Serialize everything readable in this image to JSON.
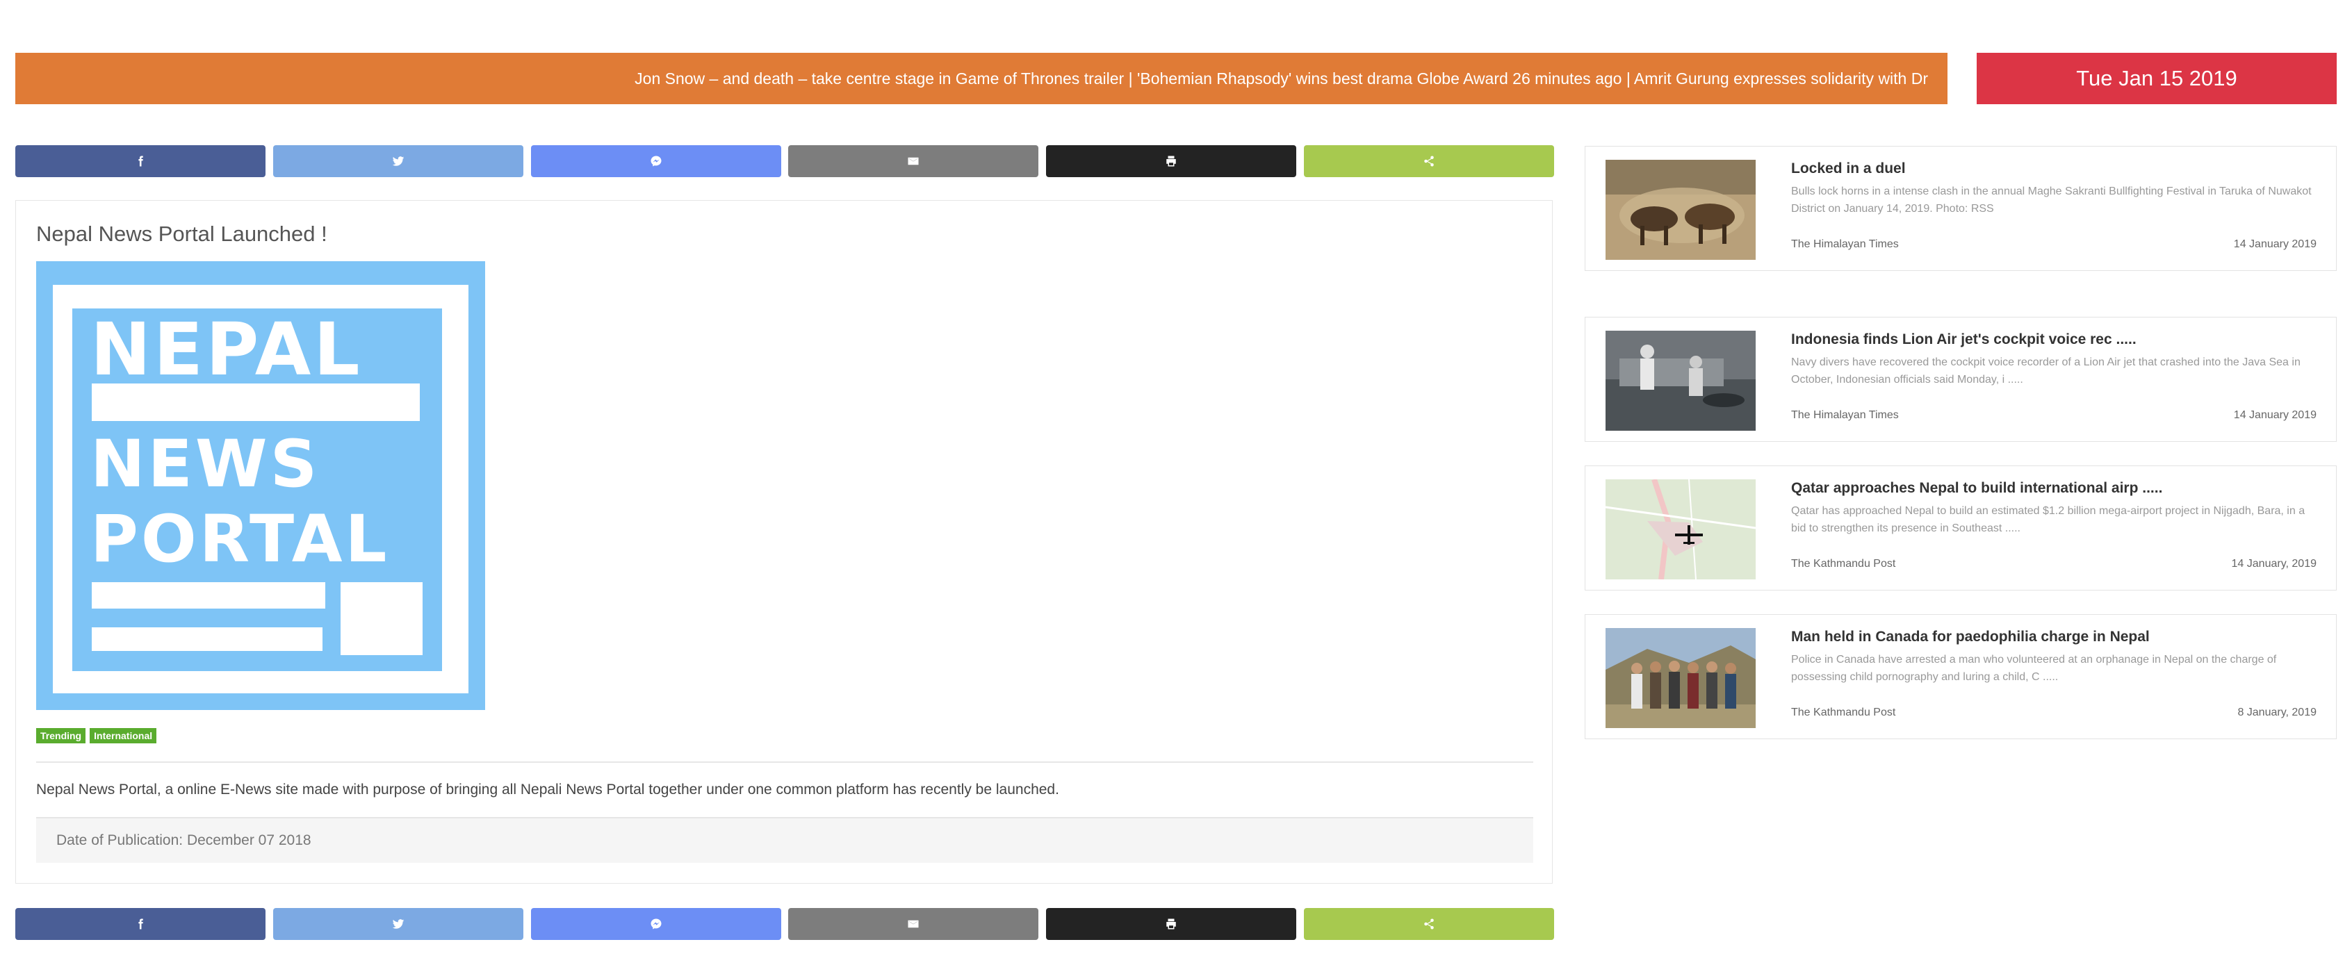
{
  "ticker": {
    "text": "Jon Snow – and death – take centre stage in Game of Thrones trailer | 'Bohemian Rhapsody' wins best drama Globe Award 26 minutes ago | Amrit Gurung expresses solidarity with Dr"
  },
  "date": "Tue Jan 15 2019",
  "share_buttons": [
    {
      "name": "facebook",
      "icon": "facebook-icon",
      "color": "#4a5e96"
    },
    {
      "name": "twitter",
      "icon": "twitter-icon",
      "color": "#7ca9e3"
    },
    {
      "name": "messenger",
      "icon": "messenger-icon",
      "color": "#6c8ef5"
    },
    {
      "name": "email",
      "icon": "email-icon",
      "color": "#7d7d7d"
    },
    {
      "name": "print",
      "icon": "print-icon",
      "color": "#232323"
    },
    {
      "name": "share",
      "icon": "share-icon",
      "color": "#a7c94f"
    }
  ],
  "article": {
    "title": "Nepal News Portal Launched !",
    "logo": {
      "line1": "NEPAL",
      "line2": "NEWS",
      "line3": "PORTAL"
    },
    "tags": [
      "Trending",
      "International"
    ],
    "body": "Nepal News Portal, a online E-News site made with purpose of bringing all Nepali News Portal together under one common platform has recently be launched.",
    "publication": "Date of Publication: December 07 2018"
  },
  "news": [
    {
      "title": "Locked in a duel",
      "desc": "Bulls lock horns in a intense clash in the annual Maghe Sakranti Bullfighting Festival in Taruka of Nuwakot District on January 14, 2019. Photo: RSS",
      "source": "The Himalayan Times",
      "date": "14 January 2019"
    },
    {
      "title": "Indonesia finds Lion Air jet's cockpit voice rec .....",
      "desc": "Navy divers have recovered the cockpit voice recorder of a Lion Air jet that crashed into the Java Sea in October, Indonesian officials said Monday, i .....",
      "source": "The Himalayan Times",
      "date": "14 January 2019"
    },
    {
      "title": "Qatar approaches Nepal to build international airp .....",
      "desc": "Qatar has approached Nepal to build an estimated $1.2 billion mega-airport project in Nijgadh, Bara, in a bid to strengthen its presence in Southeast .....",
      "source": "The Kathmandu Post",
      "date": "14 January, 2019"
    },
    {
      "title": "Man held in Canada for paedophilia charge in Nepal",
      "desc": "Police in Canada have arrested a man who volunteered at an orphanage in Nepal on the charge of possessing child pornography and luring a child, C .....",
      "source": "The Kathmandu Post",
      "date": "8 January, 2019"
    }
  ]
}
